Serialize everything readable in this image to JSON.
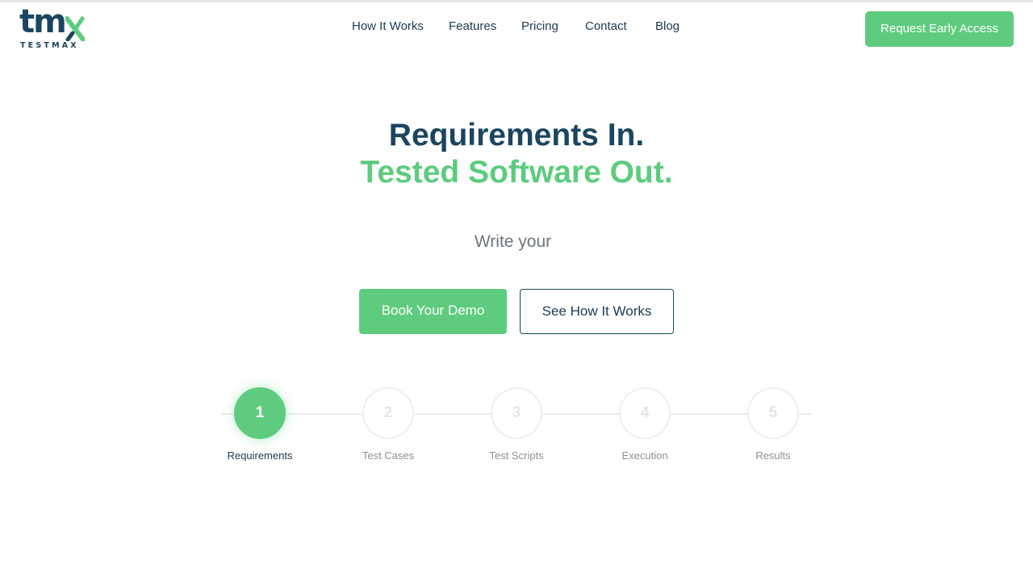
{
  "logo": {
    "mark": "tm",
    "wordmark": "TESTMAX"
  },
  "nav": {
    "items": [
      {
        "label": "How It Works"
      },
      {
        "label": "Features"
      },
      {
        "label": "Pricing"
      },
      {
        "label": "Contact"
      },
      {
        "label": "Blog"
      }
    ]
  },
  "header": {
    "cta_label": "Request Early Access"
  },
  "hero": {
    "headline_1": "Requirements In.",
    "headline_2": "Tested Software Out.",
    "subtitle": "Write your",
    "primary_button": "Book Your Demo",
    "secondary_button": "See How It Works"
  },
  "steps": [
    {
      "number": "1",
      "label": "Requirements",
      "active": true
    },
    {
      "number": "2",
      "label": "Test Cases",
      "active": false
    },
    {
      "number": "3",
      "label": "Test Scripts",
      "active": false
    },
    {
      "number": "4",
      "label": "Execution",
      "active": false
    },
    {
      "number": "5",
      "label": "Results",
      "active": false
    }
  ],
  "colors": {
    "brand_navy": "#1b4560",
    "brand_green": "#5ecb7e",
    "muted_text": "#6e757d"
  }
}
